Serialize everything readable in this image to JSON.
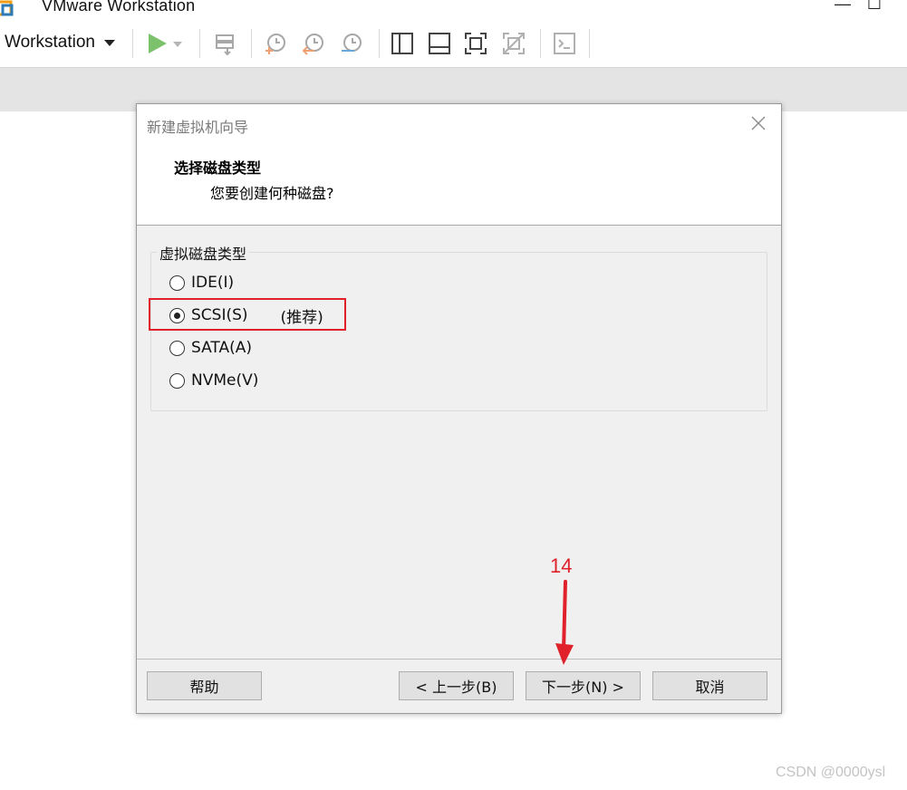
{
  "window": {
    "title": "VMware Workstation",
    "controls": {
      "minimize": "—",
      "maximize": "☐"
    }
  },
  "toolbar": {
    "menu_label": "Workstation",
    "icons": [
      "play-icon",
      "dropdown-arrow-icon",
      "send-keys-icon",
      "snapshot-take-icon",
      "snapshot-revert-icon",
      "snapshot-manager-icon",
      "sidebar-toggle-icon",
      "thumbnail-bar-icon",
      "fullscreen-icon",
      "unity-icon",
      "console-view-icon"
    ]
  },
  "dialog": {
    "title": "新建虚拟机向导",
    "heading": "选择磁盘类型",
    "subheading": "您要创建何种磁盘?",
    "group_label": "虚拟磁盘类型",
    "options": [
      {
        "label": "IDE(I)",
        "checked": false,
        "note": ""
      },
      {
        "label": "SCSI(S)",
        "checked": true,
        "note": "(推荐)"
      },
      {
        "label": "SATA(A)",
        "checked": false,
        "note": ""
      },
      {
        "label": "NVMe(V)",
        "checked": false,
        "note": ""
      }
    ],
    "buttons": {
      "help": "帮助",
      "back": "< 上一步(B)",
      "next": "下一步(N) >",
      "cancel": "取消"
    }
  },
  "annotation": {
    "step_number": "14",
    "color": "#e0202a"
  },
  "watermark": "CSDN @0000ysl",
  "colors": {
    "highlight": "#e0202a",
    "play_green": "#7cc16b",
    "dialog_bg": "#f0f0f0"
  }
}
